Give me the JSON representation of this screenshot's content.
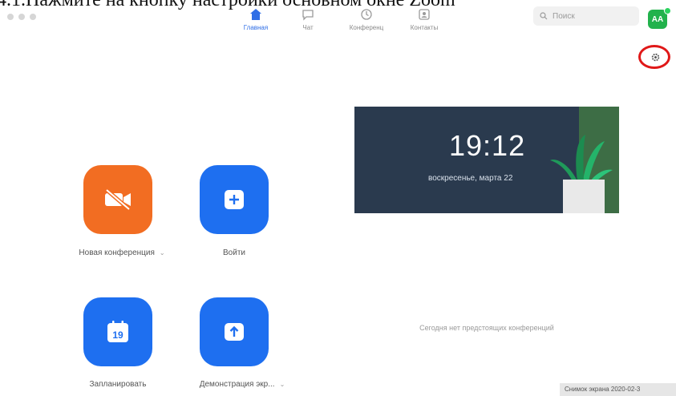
{
  "caption": "4.1.Нажмите на кнопку настройки основном окне Zoom",
  "nav": {
    "home": "Главная",
    "chat": "Чат",
    "meetings": "Конференц",
    "contacts": "Контакты"
  },
  "search": {
    "placeholder": "Поиск"
  },
  "avatar": {
    "initials": "AA"
  },
  "actions": {
    "new_meeting": "Новая конференция",
    "join": "Войти",
    "schedule": "Запланировать",
    "schedule_day": "19",
    "share_screen": "Демонстрация экр..."
  },
  "clock": {
    "time": "19:12",
    "date": "воскресенье, марта 22"
  },
  "upcoming": "Сегодня нет предстоящих конференций",
  "screenshot_stamp": "Снимок экрана 2020-02-3",
  "colors": {
    "accent": "#1e6ff0",
    "orange": "#f26d22",
    "highlight": "#e01818",
    "avatar": "#22b24c"
  }
}
